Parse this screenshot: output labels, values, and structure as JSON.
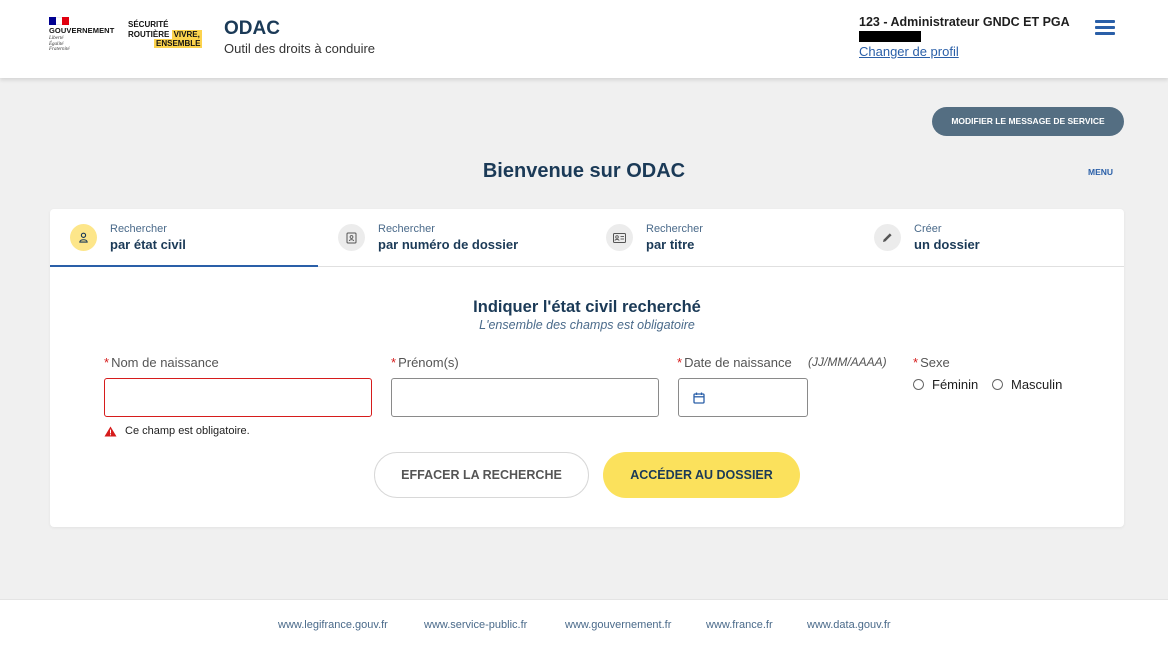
{
  "header": {
    "gouv_label": "GOUVERNEMENT",
    "gouv_motto": [
      "Liberté",
      "Égalité",
      "Fraternité"
    ],
    "sr_line1": "SÉCURITÉ",
    "sr_line2a": "ROUTIÈRE",
    "sr_line2b": "VIVRE,",
    "sr_line3": "ENSEMBLE",
    "app_title": "ODAC",
    "app_subtitle": "Outil des droits à conduire",
    "user_name": "123 - Administrateur GNDC ET PGA",
    "change_profile": "Changer de profil",
    "menu_label": "MENU"
  },
  "service_button": "MODIFIER LE MESSAGE DE SERVICE",
  "welcome": "Bienvenue sur ODAC",
  "tabs": [
    {
      "line1": "Rechercher",
      "line2": "par état civil",
      "icon": "person-icon"
    },
    {
      "line1": "Rechercher",
      "line2": "par numéro de dossier",
      "icon": "folder-icon"
    },
    {
      "line1": "Rechercher",
      "line2": "par titre",
      "icon": "id-card-icon"
    },
    {
      "line1": "Créer",
      "line2": "un dossier",
      "icon": "pencil-icon"
    }
  ],
  "form": {
    "title": "Indiquer l'état civil recherché",
    "subtitle": "L'ensemble des champs est obligatoire",
    "required_mark": "*",
    "last_name_label": "Nom de naissance",
    "first_name_label": "Prénom(s)",
    "birth_date_label": "Date de naissance",
    "birth_date_format": "(JJ/MM/AAAA)",
    "sex_label": "Sexe",
    "sex_female": "Féminin",
    "sex_male": "Masculin",
    "last_name_value": "",
    "first_name_value": "",
    "birth_date_value": "",
    "error_message": "Ce champ est obligatoire.",
    "clear_button": "EFFACER LA RECHERCHE",
    "submit_button": "ACCÉDER AU DOSSIER"
  },
  "footer_links": [
    "www.legifrance.gouv.fr",
    "www.service-public.fr",
    "www.gouvernement.fr",
    "www.france.fr",
    "www.data.gouv.fr"
  ],
  "colors": {
    "primary_blue": "#2a5fa8",
    "title_navy": "#1b3a57",
    "accent_yellow": "#fbe15c",
    "error_red": "#d61c1c",
    "service_button_bg": "#546e82"
  }
}
